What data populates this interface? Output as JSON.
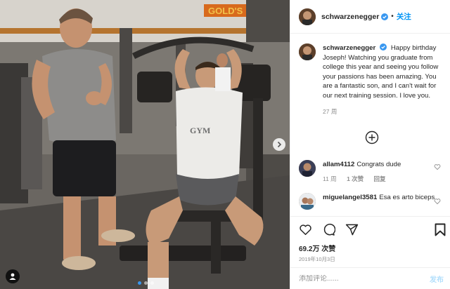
{
  "colors": {
    "accent": "#0095f6",
    "verified": "#3897f0",
    "muted": "#8e8e8e",
    "text": "#262626",
    "post_disabled": "#b2dffc"
  },
  "gym_sign": "GOLD'S",
  "shirt_print": "GYM",
  "header": {
    "username": "schwarzenegger",
    "separator": "•",
    "follow_label": "关注"
  },
  "caption": {
    "username": "schwarzenegger",
    "text": "Happy birthday Joseph! Watching you graduate from college this year and seeing you follow your passions has been amazing. You are a fantastic son, and I can't wait for our next training session. I love you.",
    "time": "27 周"
  },
  "comments": [
    {
      "username": "allam4112",
      "text": "Congrats dude",
      "time": "11 周",
      "likes": "1 次赞",
      "reply": "回复"
    },
    {
      "username": "miguelangel3581",
      "text": "Esa es arto biceps"
    }
  ],
  "likes": "69.2万 次赞",
  "date": "2019年10月3日",
  "add_comment": {
    "placeholder": "添加评论......",
    "post_label": "发布"
  },
  "icons": [
    "verified-icon",
    "load-more-icon",
    "heart-icon",
    "comment-icon",
    "share-icon",
    "bookmark-icon",
    "next-arrow-icon",
    "tag-user-icon"
  ]
}
